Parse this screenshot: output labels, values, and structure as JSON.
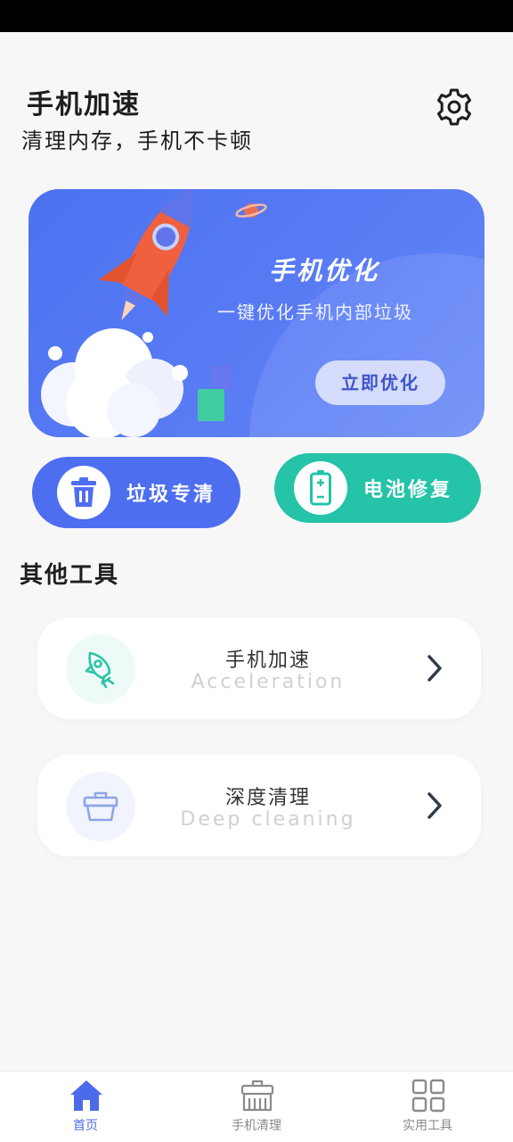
{
  "header": {
    "title": "手机加速",
    "subtitle": "清理内存，手机不卡顿",
    "settings_icon": "gear-icon"
  },
  "banner": {
    "title": "手机优化",
    "subtitle": "一键优化手机内部垃圾",
    "button_label": "立即优化",
    "background_color": "#5a7cf5"
  },
  "quick_actions": [
    {
      "label": "垃圾专清",
      "icon": "trash-icon",
      "color": "#4e6ef0"
    },
    {
      "label": "电池修复",
      "icon": "battery-icon",
      "color": "#25c3a8"
    }
  ],
  "tools_section": {
    "title": "其他工具",
    "items": [
      {
        "name": "手机加速",
        "subtitle": "Acceleration",
        "icon": "rocket-icon",
        "icon_color": "#2cc3a6"
      },
      {
        "name": "深度清理",
        "subtitle": "Deep cleaning",
        "icon": "basket-icon",
        "icon_color": "#8fa4e8"
      }
    ]
  },
  "tab_bar": {
    "active_color": "#4b6bea",
    "tabs": [
      {
        "label": "首页",
        "icon": "home-icon",
        "active": true
      },
      {
        "label": "手机清理",
        "icon": "broom-icon",
        "active": false
      },
      {
        "label": "实用工具",
        "icon": "grid-icon",
        "active": false
      }
    ]
  }
}
